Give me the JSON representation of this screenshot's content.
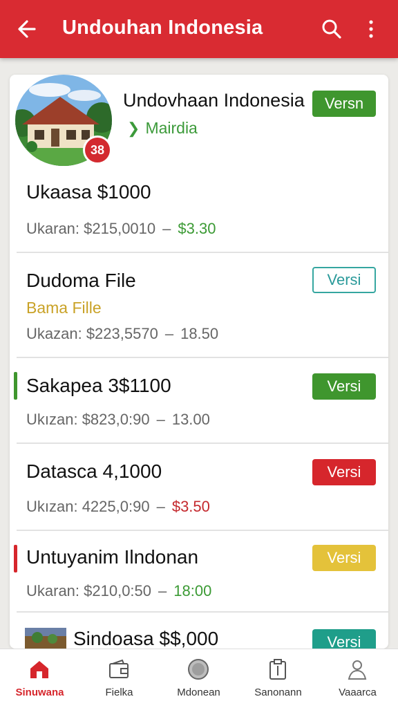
{
  "appbar": {
    "title": "Undouhan Indonesia"
  },
  "header": {
    "title": "Undovhaan Indonesia",
    "subtitle": "Mairdia",
    "badge_count": "38",
    "version_label": "Versn"
  },
  "items": [
    {
      "title": "Ukaasa $1000",
      "meta": "Ukaran: $215,0010",
      "amount": "$3.30"
    },
    {
      "title": "Dudoma File",
      "subtitle": "Bama Fille",
      "meta": "Ukazan: $223,5570",
      "amount": "18.50",
      "version_label": "Versi"
    },
    {
      "title": "Sakapea 3$1100",
      "meta": "Ukızan: $823,0:90",
      "amount": "13.00",
      "version_label": "Versi"
    },
    {
      "title": "Datasca 4,1000",
      "meta": "Ukızan: 4225,0:90",
      "amount": "$3.50",
      "version_label": "Versi"
    },
    {
      "title": "Untuyanim Ilndonan",
      "meta": "Ukaran: $210,0:50",
      "amount": "18:00",
      "version_label": "Versi"
    },
    {
      "title": "Sindoasa $$,000",
      "version_label": "Versi"
    }
  ],
  "colors": {
    "primary": "#d92b32",
    "green": "#3f962e",
    "teal": "#35a6a0",
    "red": "#d6262c",
    "yellow": "#e4c23a"
  },
  "bottom_nav": [
    {
      "label": "Sinuwana",
      "icon": "home-icon",
      "active": true
    },
    {
      "label": "Fielka",
      "icon": "wallet-icon"
    },
    {
      "label": "Mdonean",
      "icon": "coin-icon"
    },
    {
      "label": "Sanonann",
      "icon": "clipboard-icon"
    },
    {
      "label": "Vaaarca",
      "icon": "profile-icon"
    }
  ]
}
